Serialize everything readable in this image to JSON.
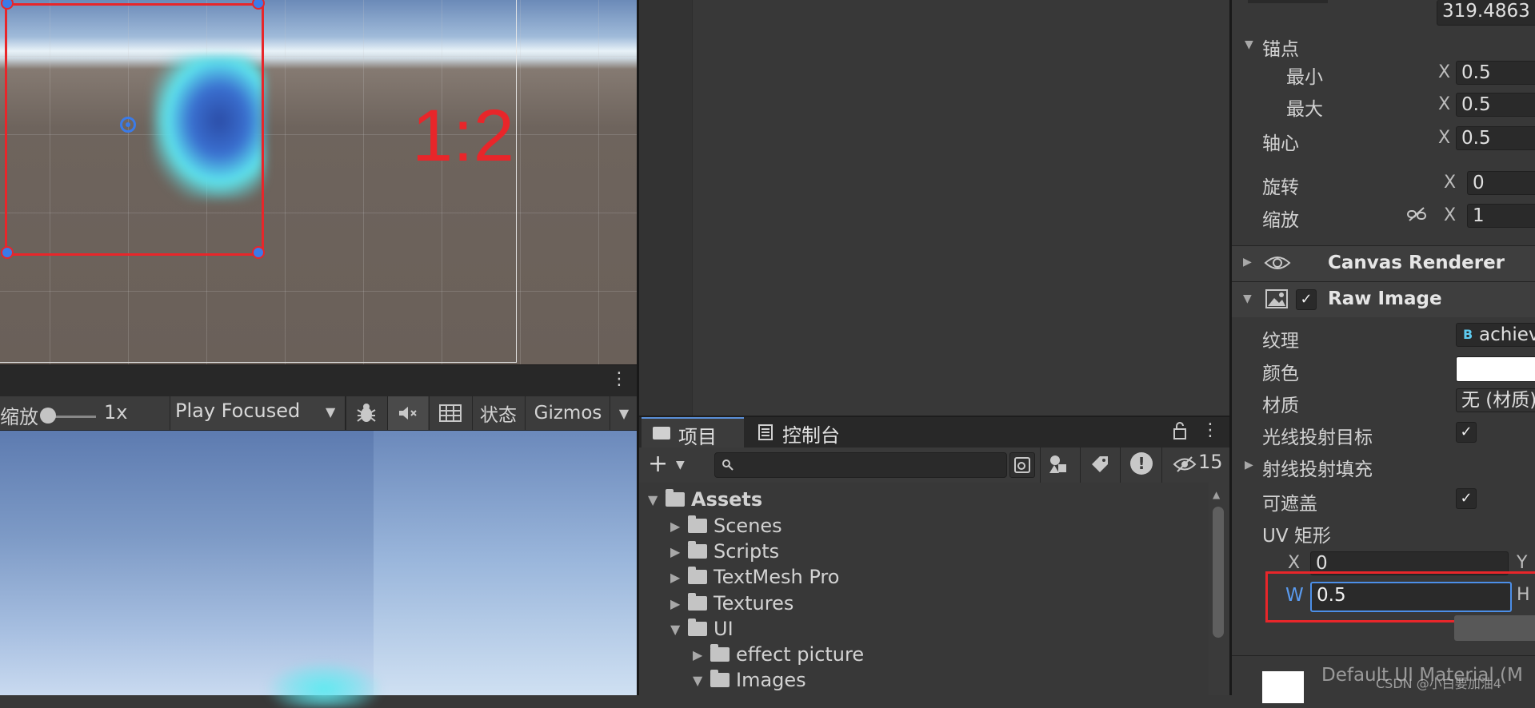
{
  "scene": {
    "ratio_label": "1:2"
  },
  "game_toolbar": {
    "scale_label": "缩放",
    "scale_value": "1x",
    "play_mode": "Play Focused",
    "stats_label": "状态",
    "gizmos_label": "Gizmos"
  },
  "project_panel": {
    "tabs": [
      {
        "label": "项目",
        "icon": "folder-icon"
      },
      {
        "label": "控制台",
        "icon": "console-icon"
      }
    ],
    "hidden_count": "15",
    "tree": [
      {
        "label": "Assets",
        "expanded": true
      },
      {
        "label": "Scenes"
      },
      {
        "label": "Scripts"
      },
      {
        "label": "TextMesh Pro"
      },
      {
        "label": "Textures"
      },
      {
        "label": "UI",
        "expanded": true
      },
      {
        "label": "effect picture"
      },
      {
        "label": "Images",
        "expanded": true
      }
    ]
  },
  "inspector": {
    "top_value": "319.4863",
    "anchor": {
      "label": "锚点",
      "min_label": "最小",
      "min_x": "0.5",
      "max_label": "最大",
      "max_x": "0.5"
    },
    "pivot": {
      "label": "轴心",
      "x": "0.5"
    },
    "rotation": {
      "label": "旋转",
      "x": "0"
    },
    "scale": {
      "label": "缩放",
      "x": "1"
    },
    "axis_x": "X",
    "canvas_renderer": {
      "title": "Canvas Renderer"
    },
    "raw_image": {
      "title": "Raw Image",
      "texture_label": "纹理",
      "texture_value": "achiev",
      "color_label": "颜色",
      "material_label": "材质",
      "material_value": "无 (材质)",
      "raycast_target_label": "光线投射目标",
      "raycast_padding_label": "射线投射填充",
      "maskable_label": "可遮盖",
      "uv_rect_label": "UV 矩形",
      "uv_x_label": "X",
      "uv_x": "0",
      "uv_y_label": "Y",
      "uv_w_label": "W",
      "uv_w": "0.5",
      "uv_h_label": "H"
    },
    "material_footer": "Default UI Material (M"
  },
  "watermark": "CSDN @小白要加油4"
}
